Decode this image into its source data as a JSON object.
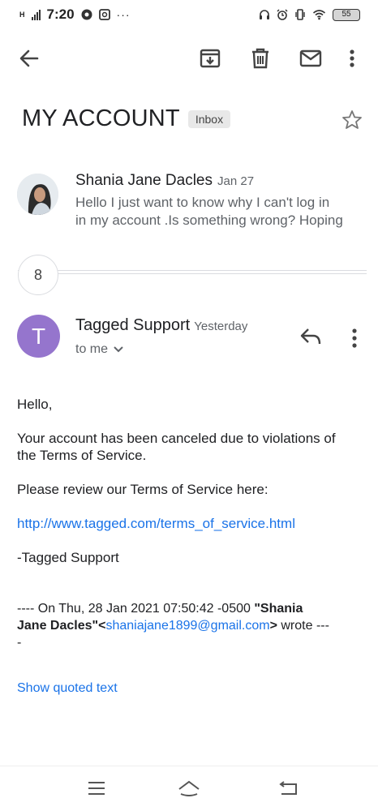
{
  "status_bar": {
    "time": "7:20",
    "battery": "55",
    "network": "H"
  },
  "app_bar": {
    "icons": [
      "back-arrow-icon",
      "archive-icon",
      "delete-icon",
      "mail-icon",
      "more-vert-icon"
    ]
  },
  "subject": {
    "title": "MY ACCOUNT",
    "label": "Inbox"
  },
  "collapsed_message": {
    "sender": "Shania Jane Dacles",
    "date": "Jan 27",
    "snippet_line1": "Hello I just want to know why I can't log in",
    "snippet_line2": "in my account .Is something wrong? Hoping"
  },
  "collapsed_count": "8",
  "expanded_message": {
    "avatar_letter": "T",
    "avatar_color": "#9575cd",
    "sender": "Tagged Support",
    "date": "Yesterday",
    "to": "to me",
    "body": {
      "greeting": "Hello,",
      "line1a": "Your account has been canceled due to violations of",
      "line1b": "the Terms of Service.",
      "line2": "Please review our Terms of Service here:",
      "link": "http://www.tagged.com/terms_of_service.html",
      "signature": "-Tagged Support",
      "quote_prefix": "---- On  Thu, 28 Jan 2021 07:50:42 -0500 ",
      "quote_name_a": "\"Shania",
      "quote_name_b": "Jane Dacles\"",
      "quote_lt": "<",
      "quote_email": "shaniajane1899@gmail.com",
      "quote_gt": ">",
      "quote_suffix": "  wrote ---",
      "quote_tail": "-"
    },
    "show_quoted": "Show quoted text"
  },
  "colors": {
    "link": "#1a73e8",
    "secondary_text": "#5f6368",
    "divider": "#dadce0"
  }
}
